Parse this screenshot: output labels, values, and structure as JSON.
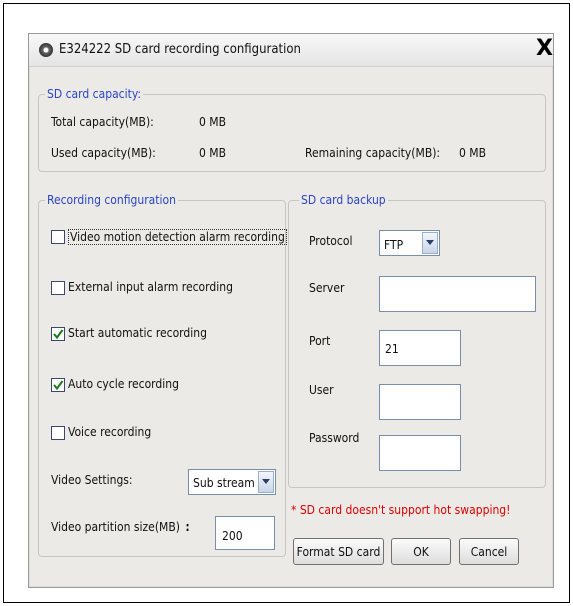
{
  "window": {
    "title": "E324222 SD card recording configuration",
    "close_label": "X"
  },
  "capacity": {
    "legend": "SD card capacity:",
    "total_label": "Total capacity(MB):",
    "total_value": "0 MB",
    "used_label": "Used capacity(MB):",
    "used_value": "0 MB",
    "remaining_label": "Remaining capacity(MB):",
    "remaining_value": "0 MB"
  },
  "recording": {
    "legend": "Recording configuration",
    "options": [
      {
        "label": "Video motion detection alarm recording",
        "checked": false
      },
      {
        "label": "External input alarm recording",
        "checked": false
      },
      {
        "label": "Start automatic recording",
        "checked": true
      },
      {
        "label": "Auto cycle recording",
        "checked": true
      },
      {
        "label": "Voice recording",
        "checked": false
      }
    ],
    "video_settings_label": "Video Settings:",
    "video_settings_value": "Sub stream",
    "partition_label": "Video partition size(MB)",
    "partition_colon": ":",
    "partition_value": "200"
  },
  "backup": {
    "legend": "SD card backup",
    "protocol_label": "Protocol",
    "protocol_value": "FTP",
    "server_label": "Server",
    "server_value": "",
    "port_label": "Port",
    "port_value": "21",
    "user_label": "User",
    "user_value": "",
    "password_label": "Password",
    "password_value": ""
  },
  "warning": "* SD card doesn't support hot swapping!",
  "buttons": {
    "format": "Format SD card",
    "ok": "OK",
    "cancel": "Cancel"
  },
  "colors": {
    "legend": "#2a45c8",
    "warning": "#e00000",
    "check": "#1a7a1a"
  }
}
